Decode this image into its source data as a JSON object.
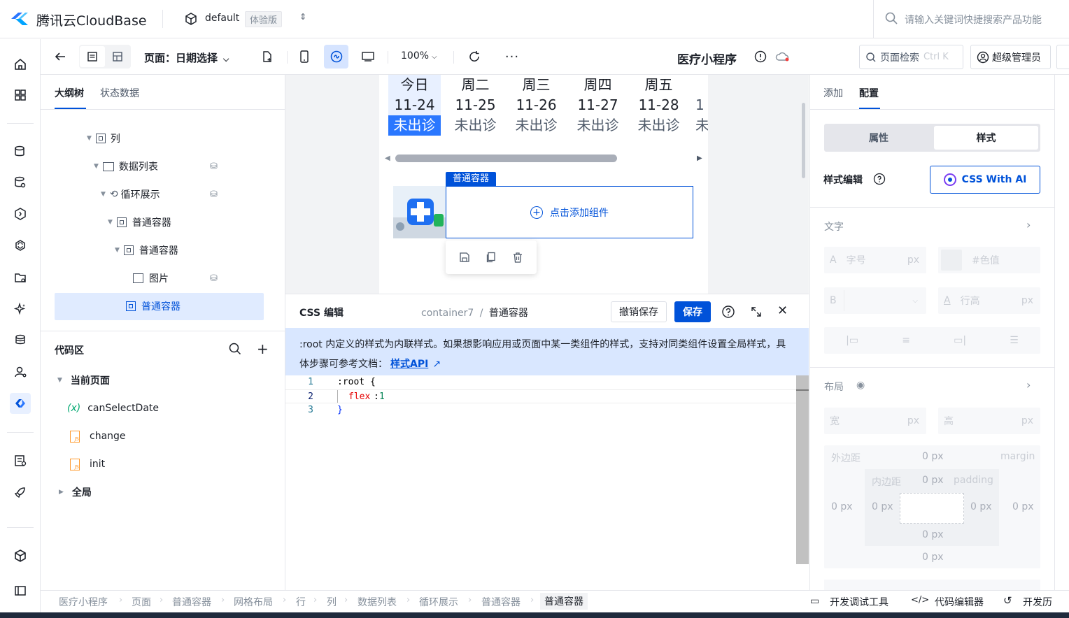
{
  "app": {
    "logo_text": "腾讯云CloudBase",
    "env_name": "default",
    "env_badge": "体验版",
    "search_placeholder": "请输入关键词快捷搜索产品功能"
  },
  "toolbar": {
    "page_label": "页面：日期选择",
    "zoom": "100%",
    "app_name": "医疗小程序",
    "page_search": "页面检索",
    "page_search_shortcut": "Ctrl K",
    "admin": "超级管理员"
  },
  "outline": {
    "tabs": [
      "大纲树",
      "状态数据"
    ],
    "tree": [
      {
        "label": "列"
      },
      {
        "label": "数据列表"
      },
      {
        "label": "循环展示"
      },
      {
        "label": "普通容器"
      },
      {
        "label": "普通容器"
      },
      {
        "label": "图片"
      },
      {
        "label": "普通容器"
      }
    ],
    "code_title": "代码区",
    "current_page": "当前页面",
    "code_items": [
      {
        "label": "canSelectDate",
        "icon": "(x)"
      },
      {
        "label": "change"
      },
      {
        "label": "init"
      }
    ],
    "global": "全局"
  },
  "canvas": {
    "dates": [
      {
        "day": "今日",
        "date": "11-24",
        "status": "未出诊"
      },
      {
        "day": "周二",
        "date": "11-25",
        "status": "未出诊"
      },
      {
        "day": "周三",
        "date": "11-26",
        "status": "未出诊"
      },
      {
        "day": "周四",
        "date": "11-27",
        "status": "未出诊"
      },
      {
        "day": "周五",
        "date": "11-28",
        "status": "未出诊"
      }
    ],
    "selected_tag": "普通容器",
    "add_component": "点击添加组件"
  },
  "css_panel": {
    "title": "CSS 编辑",
    "path_parent": "container7",
    "path_current": "普通容器",
    "revert_btn": "撤销保存",
    "save_btn": "保存",
    "notice": ":root 内定义的样式为内联样式。如果想影响应用或页面中某一类组件的样式，支持对同类组件设置全局样式，具体步骤可参考文档：",
    "notice_link": "样式API",
    "code": [
      {
        "n": "1",
        "text": ":root {"
      },
      {
        "n": "2",
        "prop": "flex",
        "val": "1"
      },
      {
        "n": "3",
        "text": "}"
      }
    ]
  },
  "right": {
    "tabs": [
      "添加",
      "配置"
    ],
    "seg": [
      "属性",
      "样式"
    ],
    "style_edit": "样式编辑",
    "css_ai": "CSS With AI",
    "text_section": "文字",
    "font_size": "字号",
    "unit_px": "px",
    "color_placeholder": "#色值",
    "line_height": "行高",
    "layout_section": "布局",
    "width": "宽",
    "height": "高",
    "margin_label": "外边距",
    "margin_word": "margin",
    "padding_label": "内边距",
    "padding_word": "padding",
    "zero_px": "0 px"
  },
  "bottom": {
    "crumbs": [
      "医疗小程序",
      "页面",
      "普通容器",
      "网格布局",
      "行",
      "列",
      "数据列表",
      "循环展示",
      "普通容器",
      "普通容器"
    ],
    "debug_tool": "开发调试工具",
    "code_editor": "代码编辑器",
    "history": "开发历"
  },
  "colors": {
    "primary": "#0052d9",
    "selected_bg": "#e0ebff",
    "notice_bg": "#d9e7ff"
  }
}
